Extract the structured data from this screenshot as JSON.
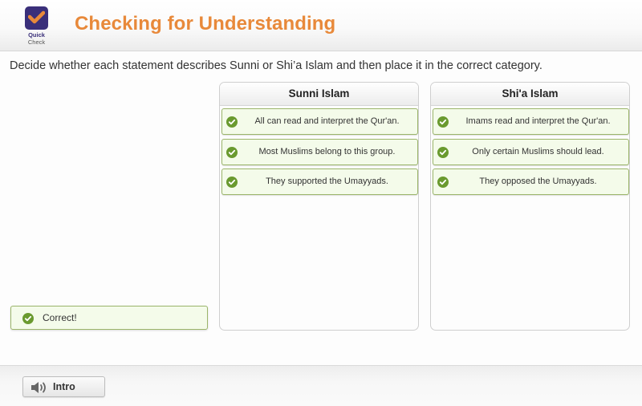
{
  "header": {
    "logo": {
      "icon": "checkmark-icon",
      "line1": "Quick",
      "line2": "Check"
    },
    "title": "Checking for Understanding"
  },
  "instructions": "Decide whether each statement describes Sunni or Shi’a Islam and then place it in the correct category.",
  "columns": [
    {
      "title": "Sunni Islam",
      "cards": [
        {
          "text": "All can read and interpret the Qur'an.",
          "status": "correct"
        },
        {
          "text": "Most Muslims belong to this group.",
          "status": "correct"
        },
        {
          "text": "They supported the Umayyads.",
          "status": "correct"
        }
      ]
    },
    {
      "title": "Shi'a Islam",
      "cards": [
        {
          "text": "Imams read and interpret the Qur'an.",
          "status": "correct"
        },
        {
          "text": "Only certain Muslims should lead.",
          "status": "correct"
        },
        {
          "text": "They opposed the Umayyads.",
          "status": "correct"
        }
      ]
    }
  ],
  "feedback": {
    "text": "Correct!",
    "icon": "check-circle-icon"
  },
  "footer": {
    "intro_label": "Intro",
    "intro_icon": "speaker-icon"
  },
  "colors": {
    "title_orange": "#e8893a",
    "logo_purple": "#3a2f7a",
    "check_green": "#6a9a2f",
    "card_bg": "#f4fbea",
    "card_border": "#9bb56a"
  }
}
